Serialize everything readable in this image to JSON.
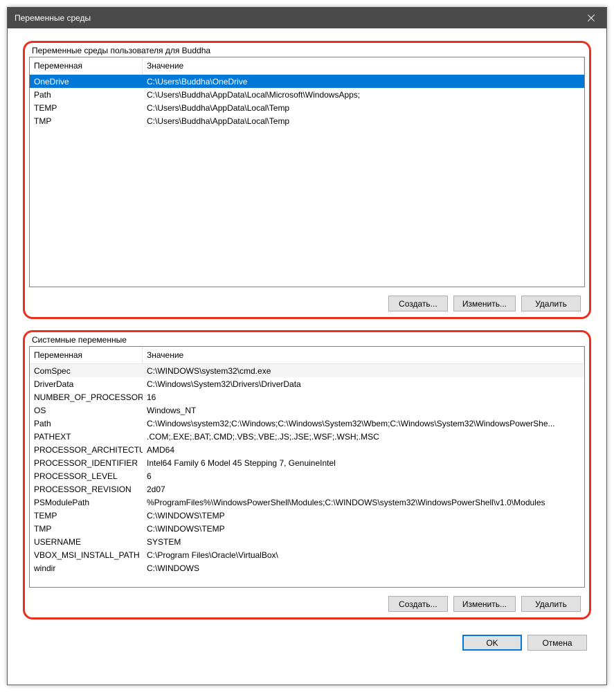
{
  "window": {
    "title": "Переменные среды"
  },
  "userGroup": {
    "label": "Переменные среды пользователя для Buddha",
    "headers": {
      "name": "Переменная",
      "value": "Значение"
    },
    "rows": [
      {
        "name": "OneDrive",
        "value": "C:\\Users\\Buddha\\OneDrive",
        "selected": true
      },
      {
        "name": "Path",
        "value": "C:\\Users\\Buddha\\AppData\\Local\\Microsoft\\WindowsApps;"
      },
      {
        "name": "TEMP",
        "value": "C:\\Users\\Buddha\\AppData\\Local\\Temp"
      },
      {
        "name": "TMP",
        "value": "C:\\Users\\Buddha\\AppData\\Local\\Temp"
      }
    ],
    "buttons": {
      "create": "Создать...",
      "edit": "Изменить...",
      "del": "Удалить"
    }
  },
  "systemGroup": {
    "label": "Системные переменные",
    "headers": {
      "name": "Переменная",
      "value": "Значение"
    },
    "rows": [
      {
        "name": "ComSpec",
        "value": "C:\\WINDOWS\\system32\\cmd.exe",
        "focus": true
      },
      {
        "name": "DriverData",
        "value": "C:\\Windows\\System32\\Drivers\\DriverData"
      },
      {
        "name": "NUMBER_OF_PROCESSORS",
        "value": "16"
      },
      {
        "name": "OS",
        "value": "Windows_NT"
      },
      {
        "name": "Path",
        "value": "C:\\Windows\\system32;C:\\Windows;C:\\Windows\\System32\\Wbem;C:\\Windows\\System32\\WindowsPowerShe..."
      },
      {
        "name": "PATHEXT",
        "value": ".COM;.EXE;.BAT;.CMD;.VBS;.VBE;.JS;.JSE;.WSF;.WSH;.MSC"
      },
      {
        "name": "PROCESSOR_ARCHITECTURE",
        "value": "AMD64"
      },
      {
        "name": "PROCESSOR_IDENTIFIER",
        "value": "Intel64 Family 6 Model 45 Stepping 7, GenuineIntel"
      },
      {
        "name": "PROCESSOR_LEVEL",
        "value": "6"
      },
      {
        "name": "PROCESSOR_REVISION",
        "value": "2d07"
      },
      {
        "name": "PSModulePath",
        "value": "%ProgramFiles%\\WindowsPowerShell\\Modules;C:\\WINDOWS\\system32\\WindowsPowerShell\\v1.0\\Modules"
      },
      {
        "name": "TEMP",
        "value": "C:\\WINDOWS\\TEMP"
      },
      {
        "name": "TMP",
        "value": "C:\\WINDOWS\\TEMP"
      },
      {
        "name": "USERNAME",
        "value": "SYSTEM"
      },
      {
        "name": "VBOX_MSI_INSTALL_PATH",
        "value": "C:\\Program Files\\Oracle\\VirtualBox\\"
      },
      {
        "name": "windir",
        "value": "C:\\WINDOWS"
      }
    ],
    "buttons": {
      "create": "Создать...",
      "edit": "Изменить...",
      "del": "Удалить"
    }
  },
  "dialogButtons": {
    "ok": "OK",
    "cancel": "Отмена"
  }
}
